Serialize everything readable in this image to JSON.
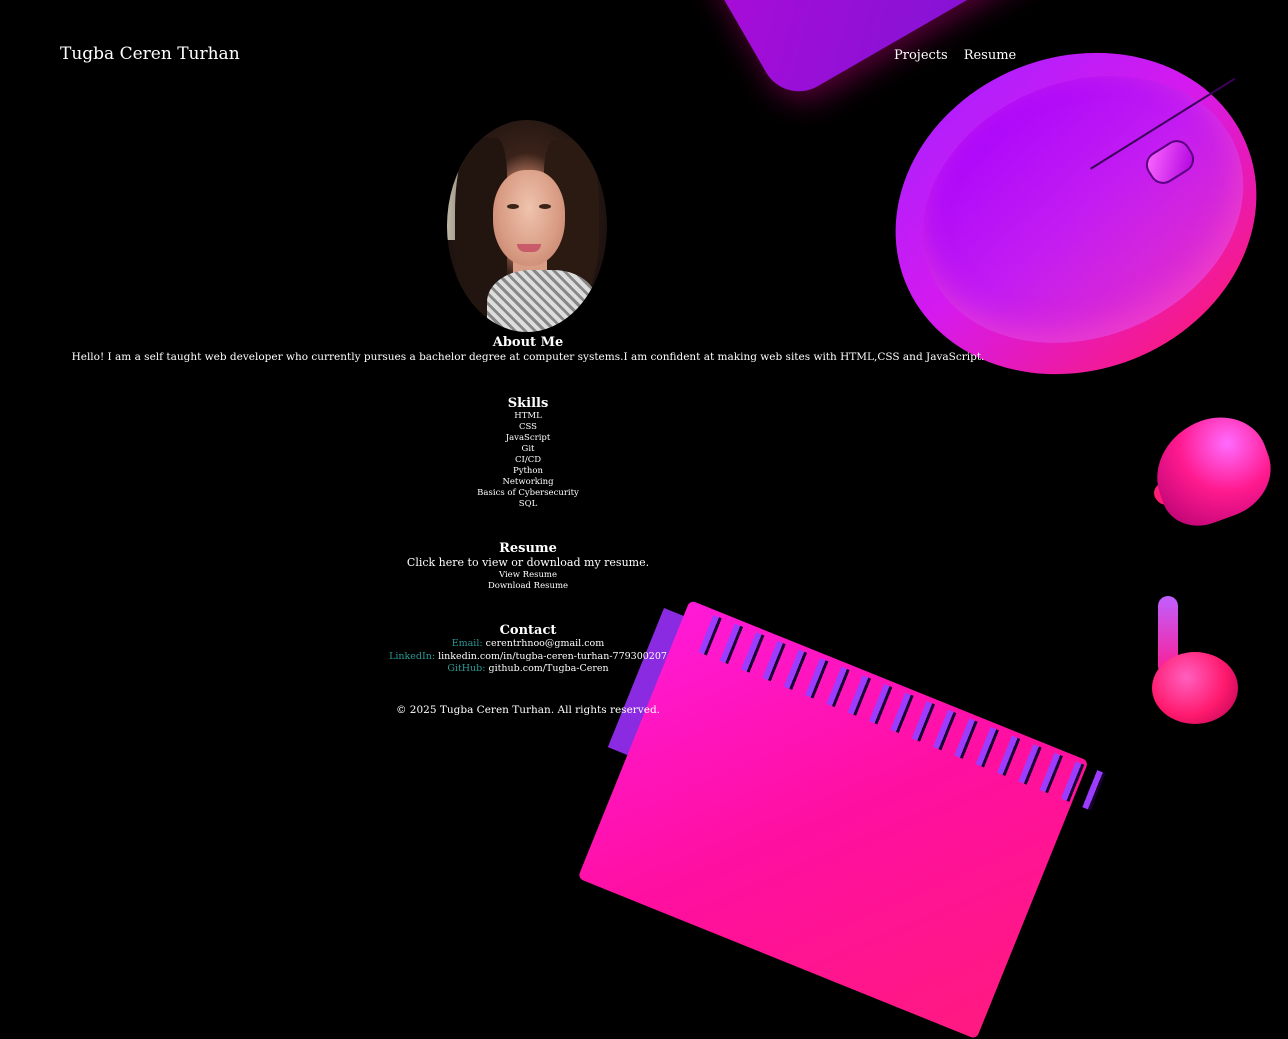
{
  "header": {
    "brand": "Tugba Ceren Turhan",
    "nav": [
      {
        "label": "Projects"
      },
      {
        "label": "Resume"
      }
    ]
  },
  "about": {
    "title": "About Me",
    "text": "Hello! I am a self taught web developer who currently pursues a bachelor degree at computer systems.I am confident at making web sites with HTML,CSS and JavaScript."
  },
  "skills": {
    "title": "Skills",
    "items": [
      "HTML",
      "CSS",
      "JavaScript",
      "Git",
      "CI/CD",
      "Python",
      "Networking",
      "Basics of Cybersecurity",
      "SQL"
    ]
  },
  "resume": {
    "title": "Resume",
    "text": "Click here to view or download my resume.",
    "view_label": "View Resume",
    "download_label": "Download Resume"
  },
  "contact": {
    "title": "Contact",
    "email_label": "Email:",
    "email_value": "cerentrhnoo@gmail.com",
    "linkedin_label": "LinkedIn:",
    "linkedin_value": "linkedin.com/in/tugba-ceren-turhan-779300207",
    "github_label": "GitHub:",
    "github_value": "github.com/Tugba-Ceren"
  },
  "footer": {
    "text": "© 2025 Tugba Ceren Turhan. All rights reserved."
  },
  "colors": {
    "background": "#000000",
    "contact_label": "#2a9a96",
    "accent_purple": "#a820ff",
    "accent_pink": "#ff1a8f"
  }
}
